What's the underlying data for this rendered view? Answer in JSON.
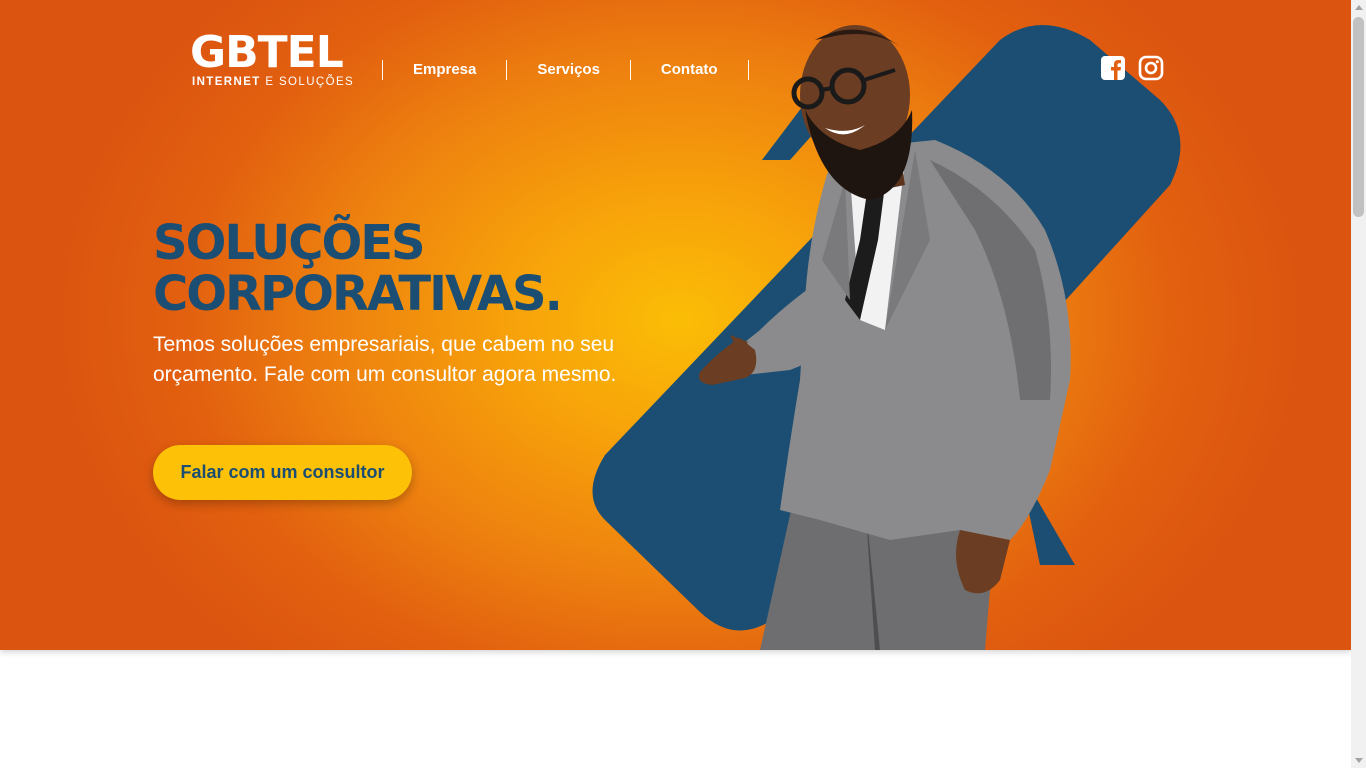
{
  "brand": {
    "logo_main": "GBTEL",
    "logo_sub_bold": "INTERNET",
    "logo_sub_rest": "E SOLUÇÕES"
  },
  "nav": {
    "items": [
      {
        "label": "Empresa"
      },
      {
        "label": "Serviços"
      },
      {
        "label": "Contato"
      }
    ]
  },
  "social": {
    "icons": [
      "facebook-icon",
      "instagram-icon"
    ]
  },
  "hero": {
    "headline_line1": "SOLUÇÕES",
    "headline_line2": "CORPORATIVAS.",
    "subtitle": "Temos soluções empresariais, que cabem no seu orçamento. Fale com um consultor agora mesmo.",
    "cta_label": "Falar com um consultor"
  },
  "colors": {
    "hero_orange": "#e2600f",
    "hero_yellow": "#fbbd06",
    "navy": "#1b4e72",
    "cta_yellow": "#fdc107",
    "white": "#ffffff"
  }
}
